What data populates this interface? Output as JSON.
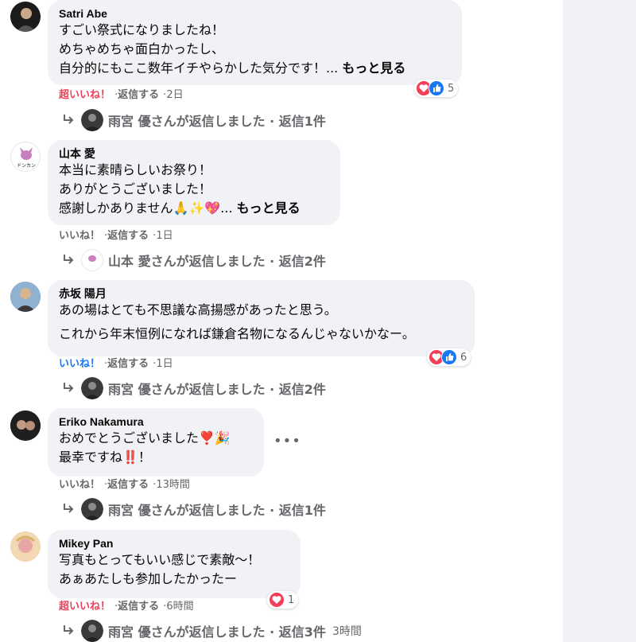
{
  "colors": {
    "bubble": "#f0f2f5",
    "love_red": "#f33e58",
    "like_blue": "#1877f2",
    "muted_gray": "#65676b",
    "sidebar": "#f0f2f5"
  },
  "comments": [
    {
      "author": "Satri Abe",
      "lines": [
        "すごい祭式になりましたね！",
        "めちゃめちゃ面白かったし、",
        "自分的にもここ数年イチやらかした気分です！..."
      ],
      "more_label": "もっと見る",
      "reaction_action": "超いいね！",
      "reply_label": "返信する",
      "time": "2日",
      "reactions": {
        "icons": [
          "love-icon",
          "like-icon"
        ],
        "count": "5"
      },
      "replies": {
        "text": "雨宮 優さんが返信しました · 返信1件",
        "time": ""
      }
    },
    {
      "author": "山本 愛",
      "lines": [
        "本当に素晴らしいお祭り！",
        "ありがとうございました！",
        "感謝しかありません🙏✨💖..."
      ],
      "more_label": "もっと見る",
      "reaction_action": "いいね！",
      "reply_label": "返信する",
      "time": "1日",
      "replies": {
        "text": "山本 愛さんが返信しました · 返信2件",
        "time": ""
      }
    },
    {
      "author": "赤坂 陽月",
      "lines": [
        "あの場はとても不思議な高揚感があったと思う。",
        "これから年末恒例になれば鎌倉名物になるんじゃないかなー。"
      ],
      "reaction_action": "いいね！",
      "reply_label": "返信する",
      "time": "1日",
      "reactions": {
        "icons": [
          "love-icon",
          "like-icon"
        ],
        "count": "6"
      },
      "replies": {
        "text": "雨宮 優さんが返信しました · 返信2件",
        "time": ""
      }
    },
    {
      "author": "Eriko Nakamura",
      "lines": [
        "おめでとうございました❣️🎉",
        "最幸ですね‼️！"
      ],
      "reaction_action": "いいね！",
      "reply_label": "返信する",
      "time": "13時間",
      "more_options": "•••",
      "replies": {
        "text": "雨宮 優さんが返信しました · 返信1件",
        "time": ""
      }
    },
    {
      "author": "Mikey Pan",
      "lines": [
        "写真もとってもいい感じで素敵〜！",
        "あぁあたしも参加したかったー"
      ],
      "reaction_action": "超いいね！",
      "reply_label": "返信する",
      "time": "6時間",
      "reactions": {
        "icons": [
          "love-icon"
        ],
        "count": "1"
      },
      "replies": {
        "text": "雨宮 優さんが返信しました · 返信3件",
        "time": "3時間"
      }
    }
  ]
}
